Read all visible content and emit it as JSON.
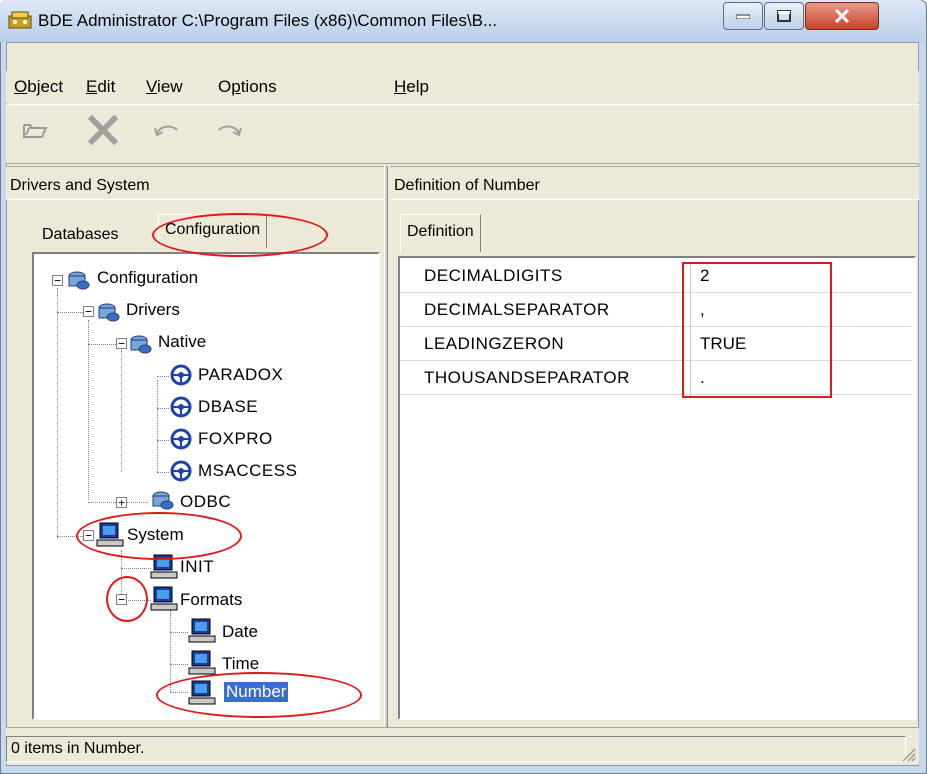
{
  "window": {
    "title": "BDE Administrator  C:\\Program Files (x86)\\Common Files\\B...",
    "minimize_icon": "minimize-icon",
    "maximize_icon": "maximize-icon",
    "close_icon": "close-icon"
  },
  "menu": {
    "object_first": "O",
    "object_rest": "bject",
    "edit_first": "E",
    "edit_rest": "dit",
    "view_first": "V",
    "view_rest": "iew",
    "options_pre": "O",
    "options_u": "p",
    "options_rest": "tions",
    "help_first": "H",
    "help_rest": "elp"
  },
  "toolbar": {
    "icons": [
      "open-icon",
      "delete-icon",
      "undo-icon",
      "redo-icon"
    ]
  },
  "left_panel": {
    "header": "Drivers and System",
    "tabs": [
      "Databases",
      "Configuration"
    ],
    "active_tab": "Configuration"
  },
  "tree": {
    "configuration": "Configuration",
    "drivers": "Drivers",
    "native": "Native",
    "paradox": "PARADOX",
    "dbase": "DBASE",
    "foxpro": "FOXPRO",
    "msaccess": "MSACCESS",
    "odbc": "ODBC",
    "system": "System",
    "init": "INIT",
    "formats": "Formats",
    "date": "Date",
    "time": "Time",
    "number": "Number",
    "selected": "Number"
  },
  "right_panel": {
    "header": "Definition of Number",
    "tab": "Definition",
    "rows": [
      {
        "name": "DECIMALDIGITS",
        "value": "2"
      },
      {
        "name": "DECIMALSEPARATOR",
        "value": ","
      },
      {
        "name": "LEADINGZERON",
        "value": "TRUE"
      },
      {
        "name": "THOUSANDSEPARATOR",
        "value": "."
      }
    ]
  },
  "status": {
    "text": "0 items in Number."
  },
  "colors": {
    "annotation": "#e0191b",
    "selection": "#3a6dd0"
  }
}
